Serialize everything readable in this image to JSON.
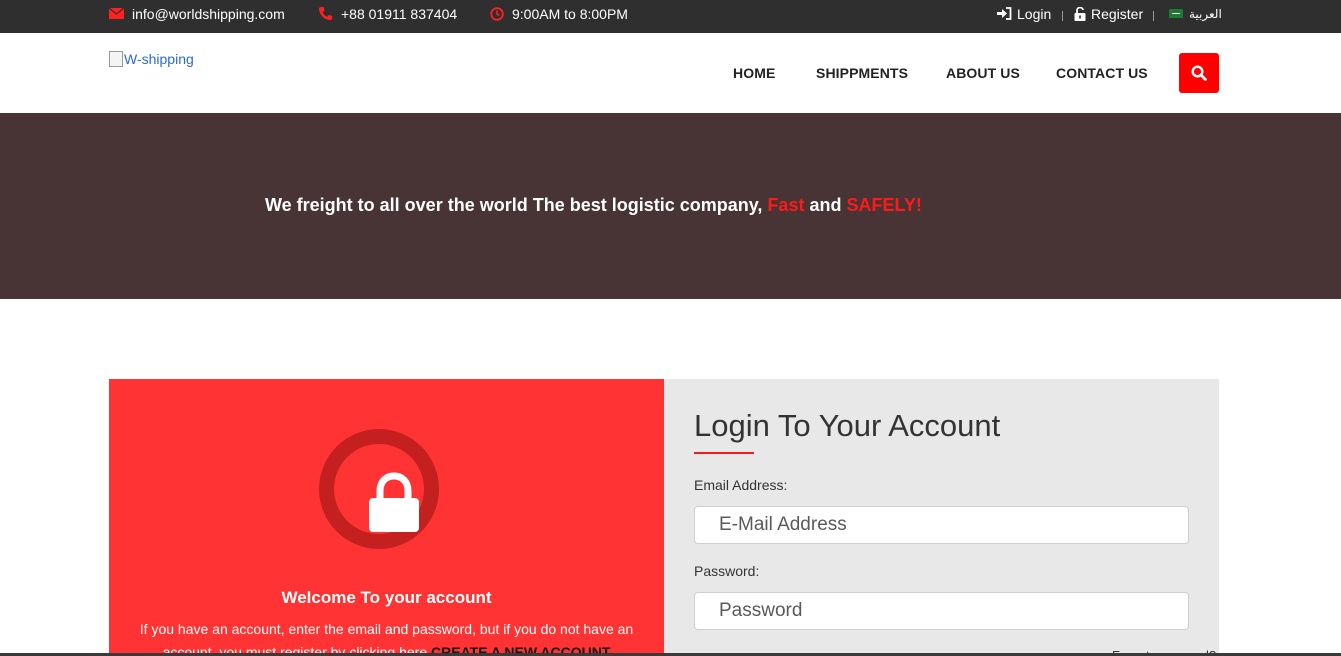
{
  "topbar": {
    "email": "info@worldshipping.com",
    "phone": "+88 01911 837404",
    "hours": "9:00AM to 8:00PM",
    "login": "Login",
    "register": "Register",
    "language": "العربية",
    "icons": [
      "envelope-icon",
      "phone-icon",
      "clock-icon",
      "sign-in-icon",
      "unlock-icon",
      "saudi-flag-icon"
    ]
  },
  "navbar": {
    "logo_alt": "W-shipping",
    "links": [
      "HOME",
      "SHIPPMENTS",
      "ABOUT US",
      "CONTACT US"
    ],
    "search_icon": "search-icon"
  },
  "hero": {
    "text_main": "We freight to all over the world The best logistic company,",
    "text_fast": "Fast",
    "text_and": "and",
    "text_safely": "SAFELY!"
  },
  "welcome": {
    "icon": "lock-icon",
    "title": "Welcome To your account",
    "description": "If you have an account, enter the email and password, but if you do not have an account, you must register by clicking here",
    "create_link": "CREATE A NEW ACCOUNT"
  },
  "login": {
    "title": "Login To Your Account",
    "email_label": "Email Address:",
    "email_placeholder": "E-Mail Address",
    "password_label": "Password:",
    "password_placeholder": "Password",
    "forgot": "Forget password?"
  },
  "colors": {
    "topbar": "#2f2f2f",
    "accent": "#ff0000",
    "hero": "#483434",
    "welcome_panel": "#ff3333",
    "login_panel": "#e8e8e8"
  }
}
